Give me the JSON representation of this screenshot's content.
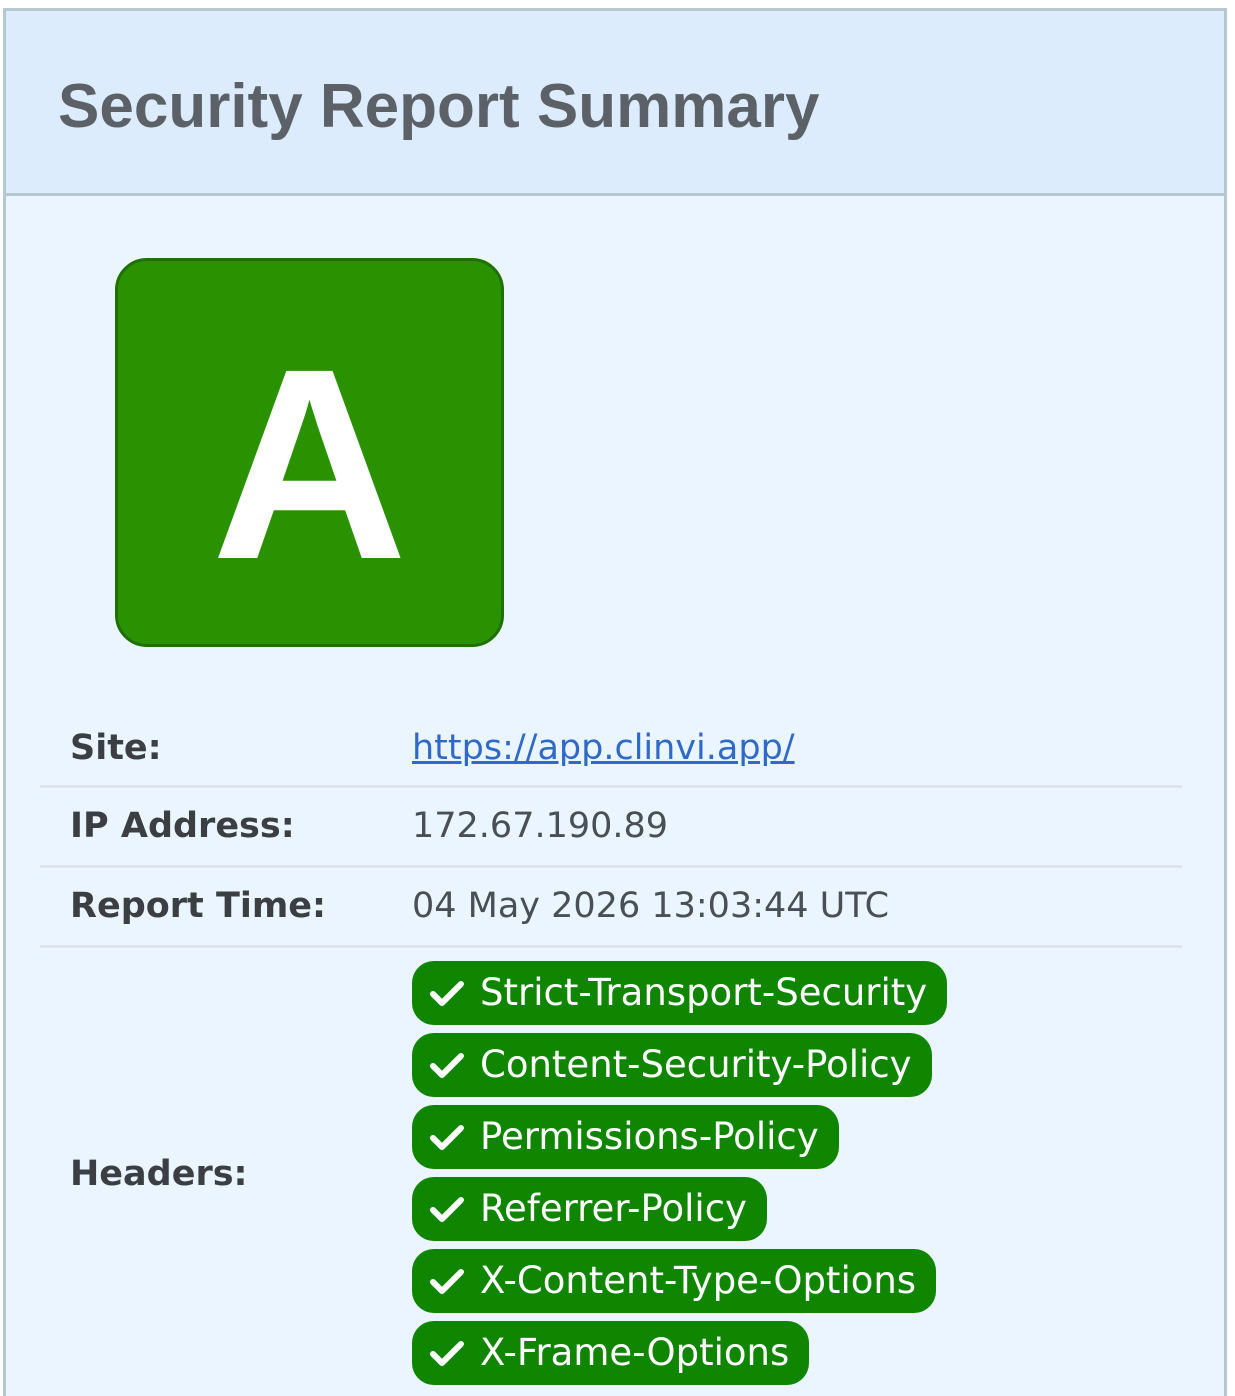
{
  "report": {
    "title": "Security Report Summary",
    "grade": "A",
    "grade_color": "#2a9200"
  },
  "summary": {
    "site_label": "Site:",
    "site_value": "https://app.clinvi.app/",
    "ip_label": "IP Address:",
    "ip_value": "172.67.190.89",
    "time_label": "Report Time:",
    "time_value": "04 May 2026 13:03:44 UTC",
    "headers_label": "Headers:",
    "headers": [
      {
        "name": "Strict-Transport-Security",
        "status": "present",
        "icon": "checkmark-icon"
      },
      {
        "name": "Content-Security-Policy",
        "status": "present",
        "icon": "checkmark-icon"
      },
      {
        "name": "Permissions-Policy",
        "status": "present",
        "icon": "checkmark-icon"
      },
      {
        "name": "Referrer-Policy",
        "status": "present",
        "icon": "checkmark-icon"
      },
      {
        "name": "X-Content-Type-Options",
        "status": "present",
        "icon": "checkmark-icon"
      },
      {
        "name": "X-Frame-Options",
        "status": "present",
        "icon": "checkmark-icon"
      }
    ],
    "badge_color": "#0f8500",
    "link_color": "#2f6ac9"
  }
}
